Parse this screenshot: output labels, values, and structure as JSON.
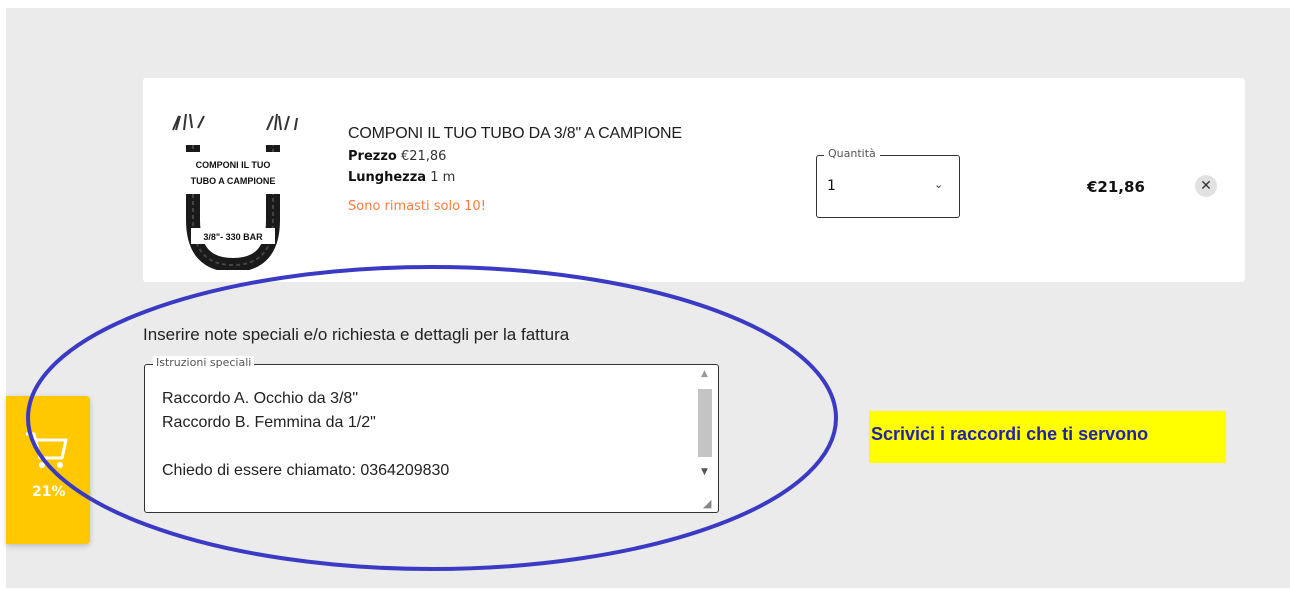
{
  "product": {
    "title": "COMPONI IL TUO TUBO DA 3/8\" A CAMPIONE",
    "price_label": "Prezzo",
    "price_value": "€21,86",
    "length_label": "Lunghezza",
    "length_value": "1 m",
    "stock_note": "Sono rimasti solo 10!",
    "thumbnail": {
      "line1": "COMPONI IL TUO",
      "line2": "TUBO A CAMPIONE",
      "line3": "3/8\"- 330 BAR"
    }
  },
  "quantity": {
    "legend": "Quantità",
    "value": "1"
  },
  "line_total": "€21,86",
  "remove_icon": "close-icon",
  "notes": {
    "label": "Inserire note speciali e/o richiesta e dettagli per la fattura",
    "legend": "Istruzioni speciali",
    "value": "Raccordo A. Occhio da 3/8\"\nRaccordo B. Femmina da 1/2\"\n\nChiedo di essere chiamato: 0364209830"
  },
  "annotation": {
    "text": "Scrivici i raccordi che ti servono",
    "ellipse_color": "#3a3ac4",
    "highlight_color": "#ffff00",
    "text_color": "#2323a8"
  },
  "cart_widget": {
    "percent": "21%",
    "icon": "cart-icon",
    "color": "#ffc800"
  },
  "colors": {
    "page_background": "#ebebeb",
    "stock_note": "#ff7b3a"
  }
}
